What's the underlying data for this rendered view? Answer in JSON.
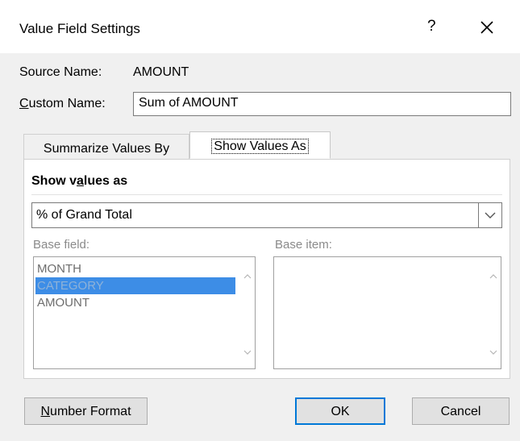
{
  "dialog": {
    "title": "Value Field Settings",
    "help_label": "?",
    "close_icon": "close-icon"
  },
  "source": {
    "label": "Source Name:",
    "value": "AMOUNT"
  },
  "custom_name": {
    "label_mnemonic": "C",
    "label_rest": "ustom Name:",
    "value": "Sum of AMOUNT"
  },
  "tabs": [
    {
      "label": "Summarize Values By",
      "active": false
    },
    {
      "label": "Show Values As",
      "active": true
    }
  ],
  "show_values": {
    "heading_pre": "Show v",
    "heading_mnemonic": "a",
    "heading_post": "lues as",
    "selected": "% of Grand Total"
  },
  "base_field": {
    "label": "Base field:",
    "items": [
      "MONTH",
      "CATEGORY",
      "AMOUNT"
    ],
    "selected_index": 1
  },
  "base_item": {
    "label": "Base item:",
    "items": []
  },
  "buttons": {
    "number_format_mnemonic": "N",
    "number_format_rest": "umber Format",
    "ok": "OK",
    "cancel": "Cancel"
  },
  "colors": {
    "selection": "#3d8de6",
    "focus_border": "#0078d7"
  }
}
